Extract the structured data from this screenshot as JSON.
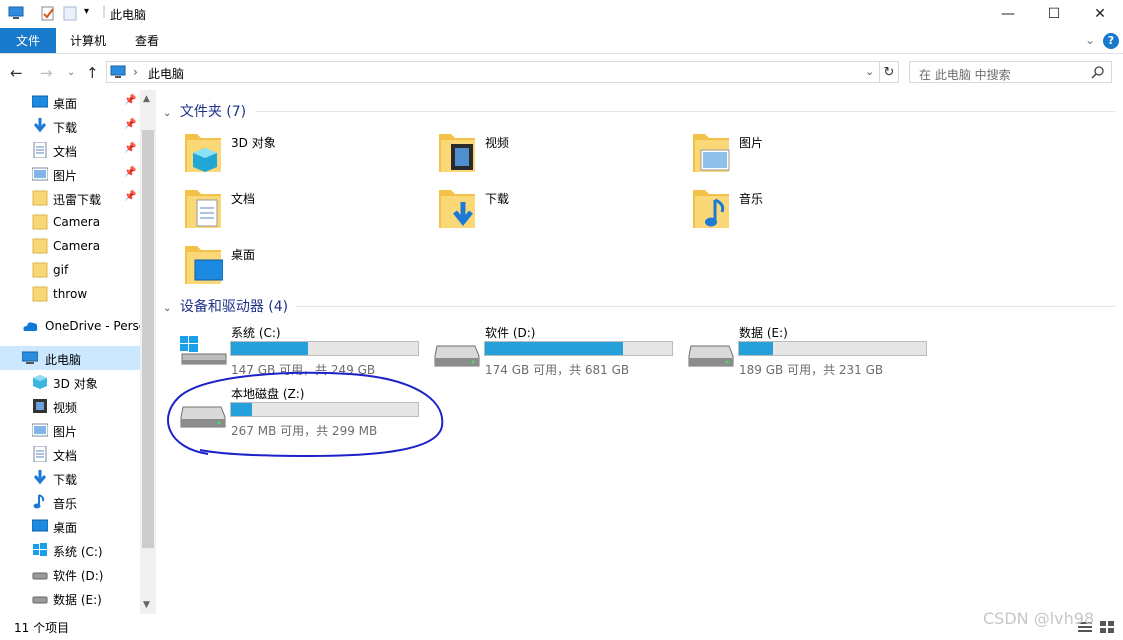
{
  "window": {
    "title": "此电脑",
    "controls": {
      "minimize": "—",
      "maximize": "☐",
      "close": "✕"
    }
  },
  "ribbon": {
    "tabs": [
      {
        "label": "文件",
        "active": true
      },
      {
        "label": "计算机"
      },
      {
        "label": "查看"
      }
    ],
    "help": "?"
  },
  "address": {
    "path": "此电脑",
    "search_placeholder": "在 此电脑 中搜索"
  },
  "nav": {
    "quick_access": [
      {
        "label": "桌面",
        "icon": "desktop-icon",
        "pinned": true
      },
      {
        "label": "下载",
        "icon": "download-icon",
        "pinned": true
      },
      {
        "label": "文档",
        "icon": "documents-icon",
        "pinned": true
      },
      {
        "label": "图片",
        "icon": "pictures-icon",
        "pinned": true
      },
      {
        "label": "迅雷下载",
        "icon": "folder-icon",
        "pinned": true
      },
      {
        "label": "Camera",
        "icon": "folder-icon"
      },
      {
        "label": "Camera",
        "icon": "folder-icon"
      },
      {
        "label": "gif",
        "icon": "folder-icon"
      },
      {
        "label": "throw",
        "icon": "folder-icon"
      }
    ],
    "onedrive": "OneDrive - Perse",
    "this_pc": "此电脑",
    "this_pc_children": [
      {
        "label": "3D 对象",
        "icon": "3d-objects-icon"
      },
      {
        "label": "视频",
        "icon": "videos-icon"
      },
      {
        "label": "图片",
        "icon": "pictures-icon"
      },
      {
        "label": "文档",
        "icon": "documents-icon"
      },
      {
        "label": "下载",
        "icon": "download-icon"
      },
      {
        "label": "音乐",
        "icon": "music-icon"
      },
      {
        "label": "桌面",
        "icon": "desktop-icon"
      },
      {
        "label": "系统 (C:)",
        "icon": "windows-drive-icon"
      },
      {
        "label": "软件 (D:)",
        "icon": "drive-icon"
      },
      {
        "label": "数据 (E:)",
        "icon": "drive-icon"
      }
    ]
  },
  "folders": {
    "header": "文件夹 (7)",
    "items": [
      {
        "label": "3D 对象",
        "icon": "3d-objects-folder-icon"
      },
      {
        "label": "视频",
        "icon": "videos-folder-icon"
      },
      {
        "label": "图片",
        "icon": "pictures-folder-icon"
      },
      {
        "label": "文档",
        "icon": "documents-folder-icon"
      },
      {
        "label": "下载",
        "icon": "download-folder-icon"
      },
      {
        "label": "音乐",
        "icon": "music-folder-icon"
      },
      {
        "label": "桌面",
        "icon": "desktop-folder-icon"
      }
    ]
  },
  "drives": {
    "header": "设备和驱动器 (4)",
    "items": [
      {
        "name": "系统 (C:)",
        "free": "147 GB 可用，共 249 GB",
        "used_fraction": 0.41,
        "icon": "windows-drive-icon"
      },
      {
        "name": "软件 (D:)",
        "free": "174 GB 可用，共 681 GB",
        "used_fraction": 0.74,
        "icon": "drive-icon"
      },
      {
        "name": "数据 (E:)",
        "free": "189 GB 可用，共 231 GB",
        "used_fraction": 0.18,
        "icon": "drive-icon"
      },
      {
        "name": "本地磁盘 (Z:)",
        "free": "267 MB 可用，共 299 MB",
        "used_fraction": 0.11,
        "icon": "drive-icon"
      }
    ]
  },
  "status": {
    "items": "11 个项目"
  },
  "watermark": "CSDN @lvh98",
  "colors": {
    "accent": "#1979ca",
    "bar": "#26a0da",
    "header": "#1e3287",
    "annotation": "#1a22c8"
  }
}
